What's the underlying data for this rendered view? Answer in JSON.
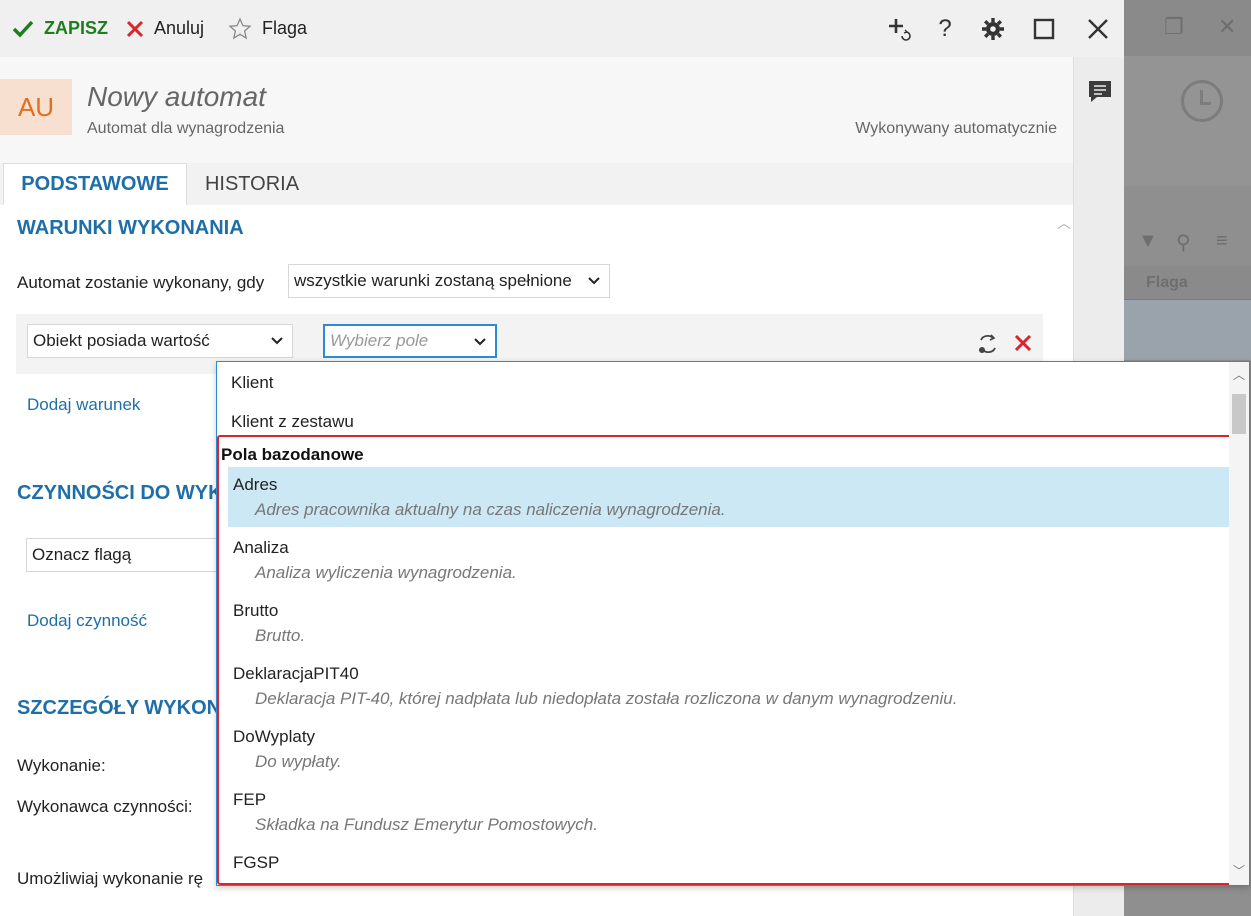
{
  "toolbar": {
    "save_label": "ZAPISZ",
    "cancel_label": "Anuluj",
    "flag_label": "Flaga",
    "help_label": "?"
  },
  "header": {
    "avatar": "AU",
    "title": "Nowy automat",
    "subtitle": "Automat dla wynagrodzenia",
    "exec_mode": "Wykonywany automatycznie"
  },
  "tabs": [
    {
      "label": "PODSTAWOWE",
      "active": true
    },
    {
      "label": "HISTORIA",
      "active": false
    }
  ],
  "conditions": {
    "section_title": "WARUNKI WYKONANIA",
    "when_label": "Automat zostanie wykonany, gdy",
    "when_value": "wszystkie warunki zostaną spełnione",
    "condition_type": "Obiekt posiada wartość",
    "field_placeholder": "Wybierz pole",
    "add_condition": "Dodaj warunek"
  },
  "actions": {
    "section_title": "CZYNNOŚCI DO WYK",
    "action_value": "Oznacz flagą",
    "add_action": "Dodaj czynność"
  },
  "details": {
    "section_title": "SZCZEGÓŁY WYKON",
    "execution_label": "Wykonanie:",
    "executor_label": "Wykonawca czynności:",
    "allow_label": "Umożliwiaj wykonanie rę"
  },
  "dropdown": {
    "plain_items": [
      "Klient",
      "Klient z zestawu"
    ],
    "group_title": "Pola bazodanowe",
    "items": [
      {
        "name": "Adres",
        "desc": "Adres pracownika aktualny na czas naliczenia wynagrodzenia.",
        "selected": true
      },
      {
        "name": "Analiza",
        "desc": "Analiza wyliczenia wynagrodzenia."
      },
      {
        "name": "Brutto",
        "desc": "Brutto."
      },
      {
        "name": "DeklaracjaPIT40",
        "desc": "Deklaracja PIT-40, której nadpłata lub niedopłata została rozliczona w danym wynagrodzeniu."
      },
      {
        "name": "DoWyplaty",
        "desc": "Do wypłaty."
      },
      {
        "name": "FEP",
        "desc": "Składka na Fundusz Emerytur Pomostowych."
      },
      {
        "name": "FGSP",
        "desc": ""
      }
    ]
  },
  "background": {
    "column_header": "Flaga"
  },
  "colors": {
    "accent": "#1e6fa8",
    "save": "#1f7d1f",
    "cancel": "#d9262c",
    "avatar_bg": "#f7e0d0",
    "avatar_fg": "#e07020",
    "selected_item": "#cce8f4"
  }
}
